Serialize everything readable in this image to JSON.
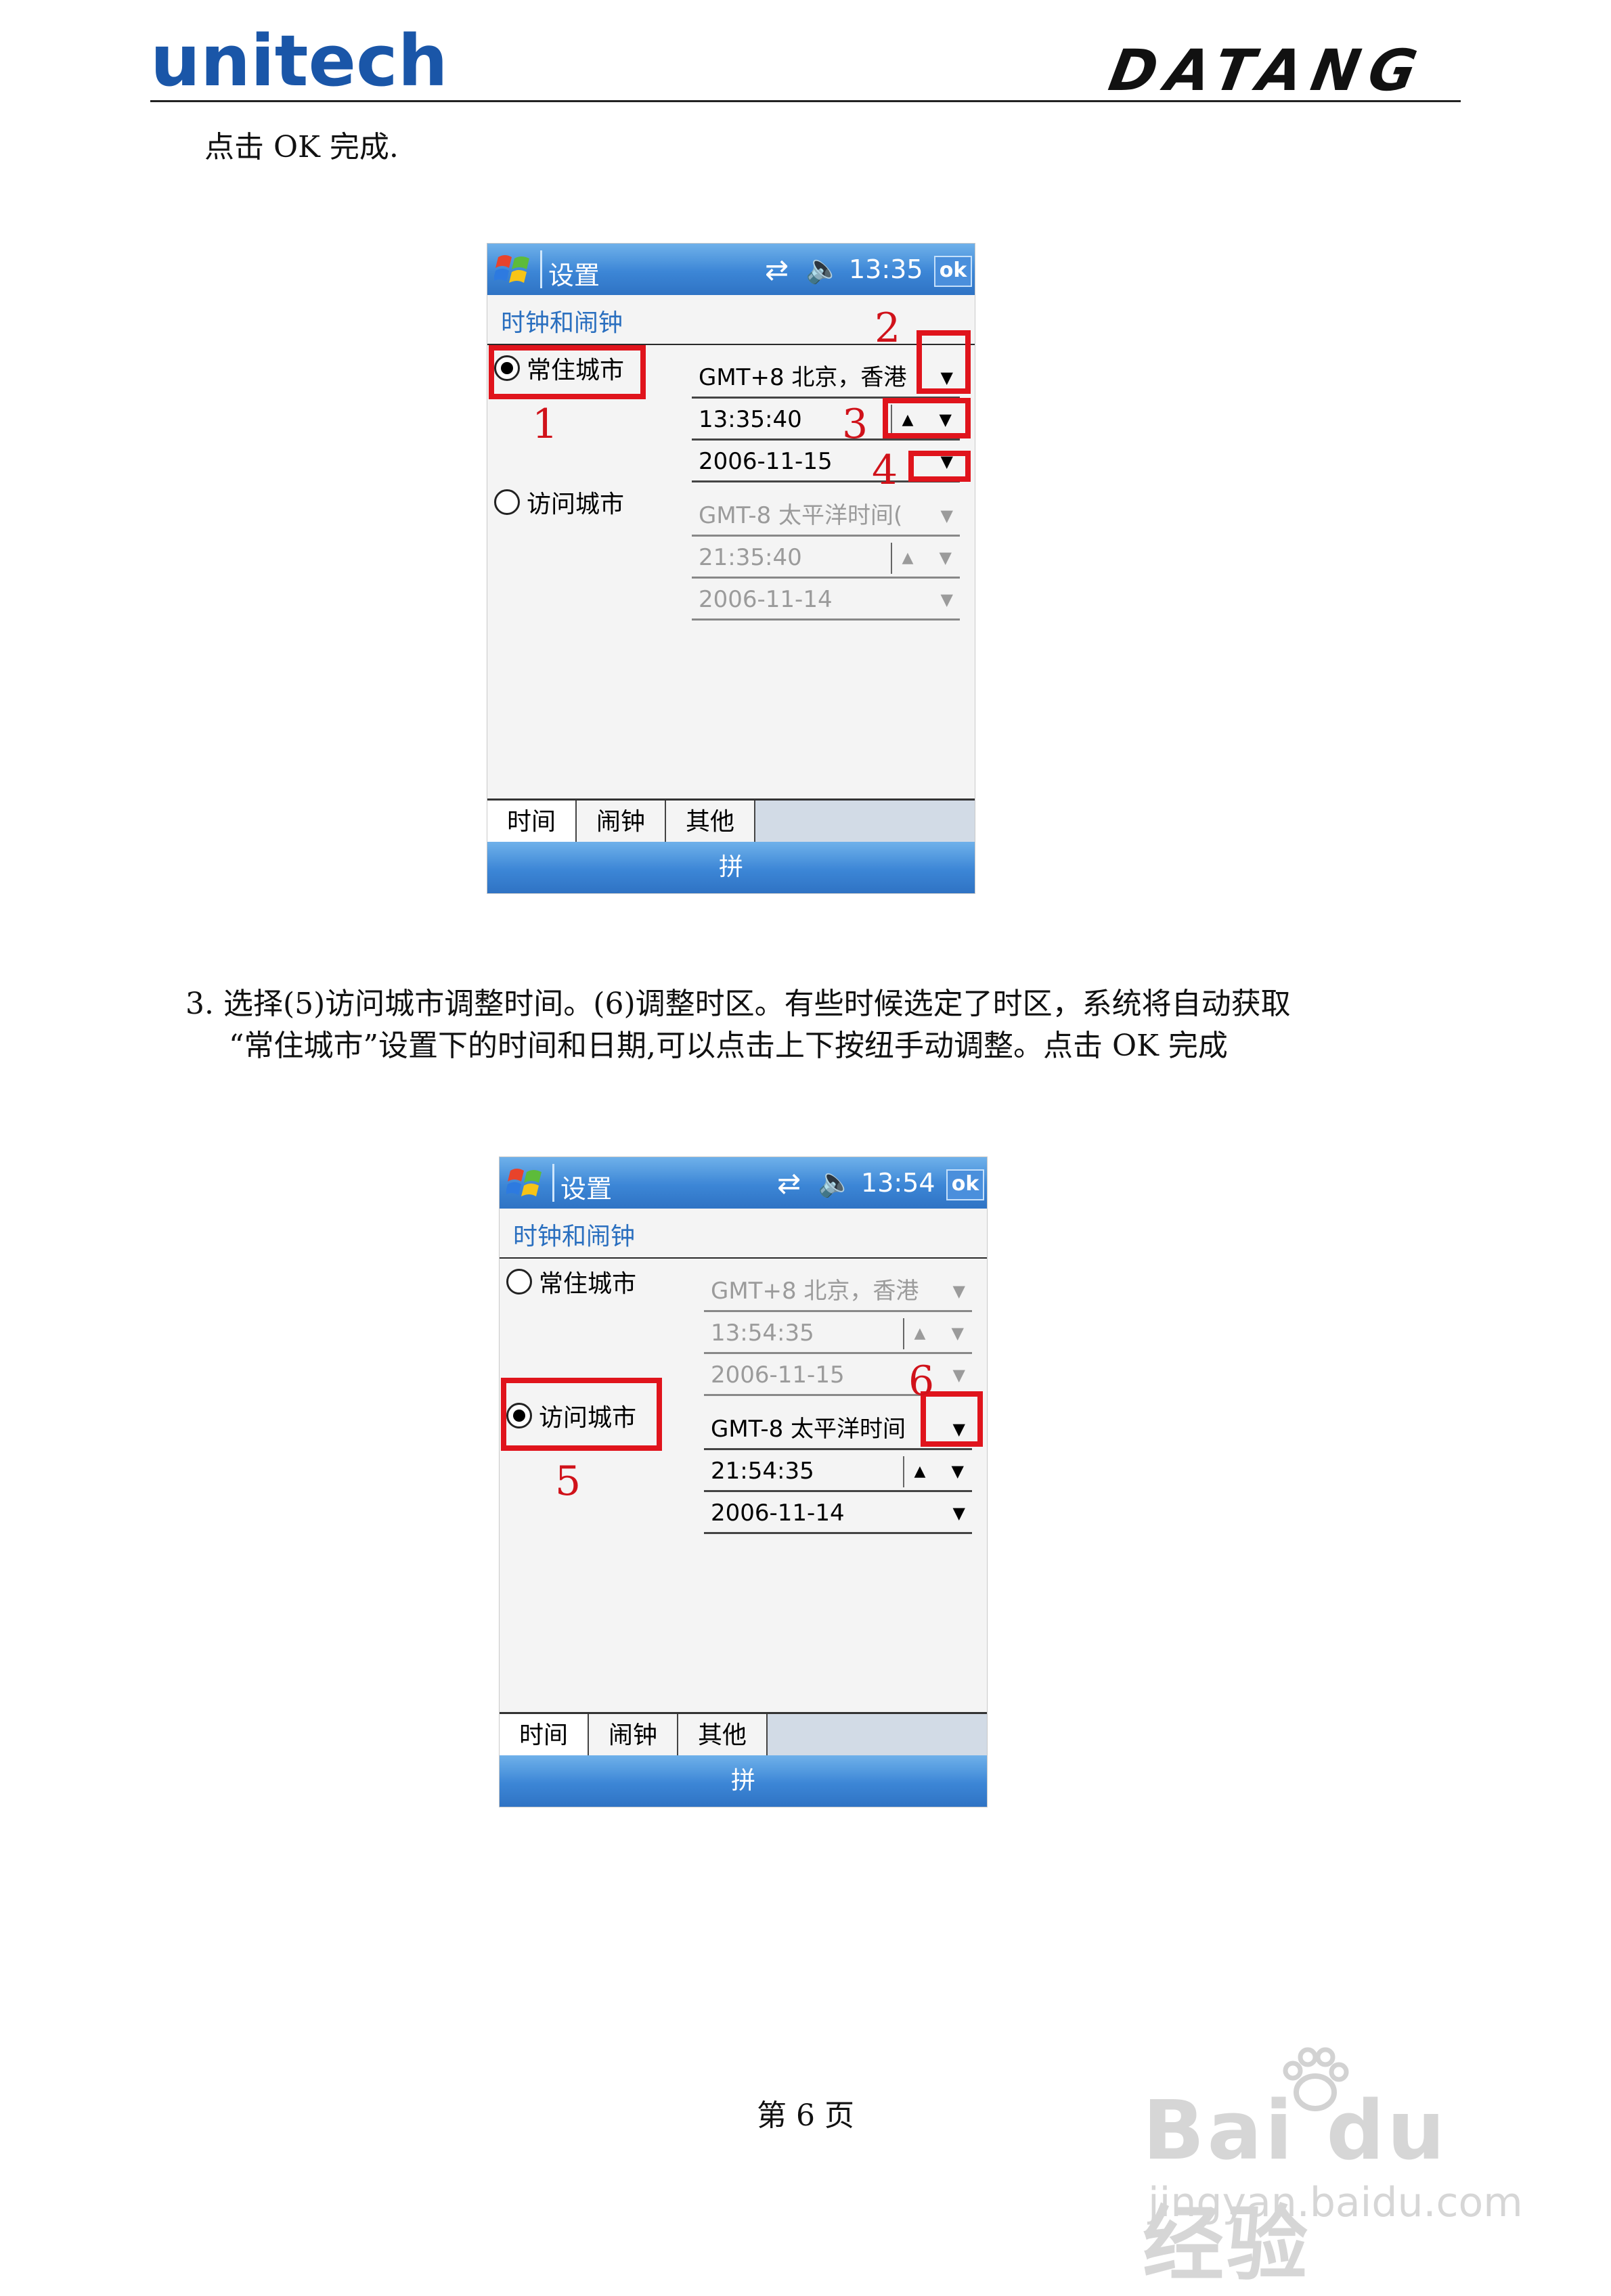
{
  "header": {
    "logo_left": "unitech",
    "logo_right": "DATANG"
  },
  "text": {
    "intro": "点击 OK 完成.",
    "step3_line1": "3.  选择(5)访问城市调整时间。(6)调整时区。有些时候选定了时区，系统将自动获取",
    "step3_line2": "“常住城市”设置下的时间和日期,可以点击上下按纽手动调整。点击 OK 完成",
    "page_number": "第 6 页"
  },
  "watermark": {
    "main": "Bai du 经验",
    "sub": "jingyan.baidu.com"
  },
  "screens": [
    {
      "title": "设置",
      "time": "13:35",
      "ok": "ok",
      "section": "时钟和闹钟",
      "home_label": "常住城市",
      "visit_label": "访问城市",
      "home_selected": true,
      "home_zone": "GMT+8 北京，香港",
      "home_time": "13:35:40",
      "home_date": "2006-11-15",
      "visit_zone": "GMT-8 太平洋时间(",
      "visit_time": "21:35:40",
      "visit_date": "2006-11-14",
      "tabs": [
        "时间",
        "闹钟",
        "其他"
      ],
      "softkey": "拼",
      "annotations": [
        "1",
        "2",
        "3",
        "4"
      ]
    },
    {
      "title": "设置",
      "time": "13:54",
      "ok": "ok",
      "section": "时钟和闹钟",
      "home_label": "常住城市",
      "visit_label": "访问城市",
      "home_selected": false,
      "home_zone": "GMT+8 北京，香港",
      "home_time": "13:54:35",
      "home_date": "2006-11-15",
      "visit_zone": "GMT-8 太平洋时间",
      "visit_time": "21:54:35",
      "visit_date": "2006-11-14",
      "tabs": [
        "时间",
        "闹钟",
        "其他"
      ],
      "softkey": "拼",
      "annotations": [
        "5",
        "6"
      ]
    }
  ],
  "icons": {
    "start": "windows-flag-icon",
    "connectivity": "connectivity-arrows-icon",
    "volume": "speaker-muted-icon",
    "dropdown": "triangle-down-icon",
    "spin_up": "triangle-up-icon"
  },
  "colors": {
    "brand_blue": "#1a56a8",
    "titlebar_blue": "#3c86d6",
    "annotation_red": "#e0141c",
    "section_title": "#2a6fbf"
  }
}
